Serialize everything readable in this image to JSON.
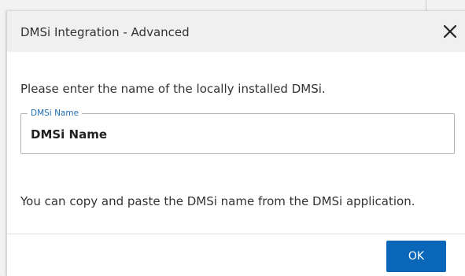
{
  "dialog": {
    "title": "DMSi Integration - Advanced",
    "close_icon": "close-icon",
    "prompt": "Please enter the name of the locally installed DMSi.",
    "field": {
      "label": "DMSi Name",
      "value": "DMSi Name"
    },
    "hint": "You can copy and paste the DMSi name from the DMSi application.",
    "ok_label": "OK"
  },
  "colors": {
    "header_bg": "#f0f0f0",
    "accent": "#0a66b8",
    "legend_text": "#1f6fb3",
    "body_text": "#333333"
  }
}
